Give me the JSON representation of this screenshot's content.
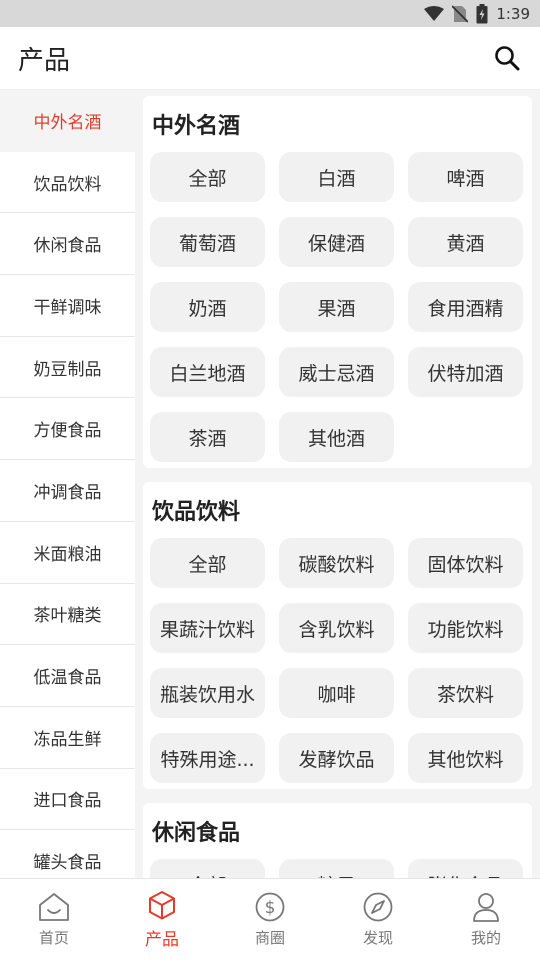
{
  "status_bar": {
    "time": "1:39"
  },
  "app_bar": {
    "title": "产品"
  },
  "sidebar": {
    "items": [
      {
        "label": "中外名酒",
        "active": true
      },
      {
        "label": "饮品饮料"
      },
      {
        "label": "休闲食品"
      },
      {
        "label": "干鲜调味"
      },
      {
        "label": "奶豆制品"
      },
      {
        "label": "方便食品"
      },
      {
        "label": "冲调食品"
      },
      {
        "label": "米面粮油"
      },
      {
        "label": "茶叶糖类"
      },
      {
        "label": "低温食品"
      },
      {
        "label": "冻品生鲜"
      },
      {
        "label": "进口食品"
      },
      {
        "label": "罐头食品"
      }
    ]
  },
  "sections": [
    {
      "title": "中外名酒",
      "chips": [
        "全部",
        "白酒",
        "啤酒",
        "葡萄酒",
        "保健酒",
        "黄酒",
        "奶酒",
        "果酒",
        "食用酒精",
        "白兰地酒",
        "威士忌酒",
        "伏特加酒",
        "茶酒",
        "其他酒"
      ]
    },
    {
      "title": "饮品饮料",
      "chips": [
        "全部",
        "碳酸饮料",
        "固体饮料",
        "果蔬汁饮料",
        "含乳饮料",
        "功能饮料",
        "瓶装饮用水",
        "咖啡",
        "茶饮料",
        "特殊用途...",
        "发酵饮品",
        "其他饮料"
      ]
    },
    {
      "title": "休闲食品",
      "chips": [
        "全部",
        "糖果",
        "膨化食品"
      ]
    }
  ],
  "bottom_nav": {
    "tabs": [
      {
        "label": "首页",
        "icon": "home-icon"
      },
      {
        "label": "产品",
        "icon": "cube-icon",
        "active": true
      },
      {
        "label": "商圈",
        "icon": "dollar-circle-icon"
      },
      {
        "label": "发现",
        "icon": "compass-icon"
      },
      {
        "label": "我的",
        "icon": "person-icon"
      }
    ]
  },
  "colors": {
    "accent": "#e53b2d"
  }
}
